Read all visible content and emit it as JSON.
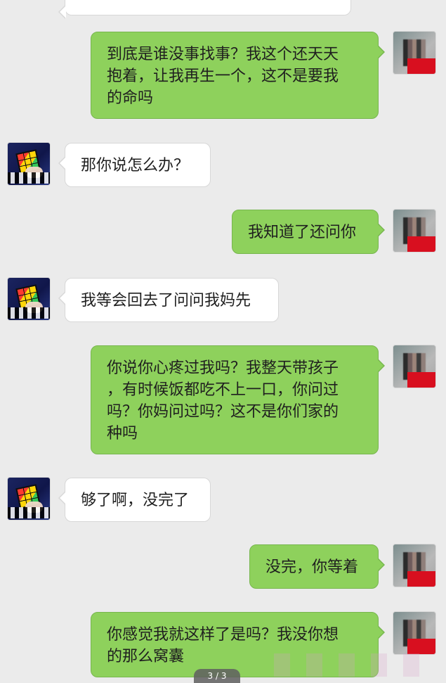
{
  "chat": {
    "messages": [
      {
        "side": "right",
        "text": "到底是谁没事找事？我这个还天天\n抱着，让我再生一个，这不是要我\n的命吗"
      },
      {
        "side": "left",
        "text": "那你说怎么办？"
      },
      {
        "side": "right",
        "text": "我知道了还问你"
      },
      {
        "side": "left",
        "text": "我等会回去了问问我妈先"
      },
      {
        "side": "right",
        "text": "你说你心疼过我吗？我整天带孩子\n，有时候饭都吃不上一口，你问过\n吗？你妈问过吗？这不是你们家的\n种吗"
      },
      {
        "side": "left",
        "text": "够了啊，没完了"
      },
      {
        "side": "right",
        "text": "没完，你等着"
      },
      {
        "side": "right",
        "text": "你感觉我就这样了是吗？我没你想\n的那么窝囊"
      }
    ]
  },
  "footer": {
    "page_indicator": "3 / 3"
  },
  "colors": {
    "background": "#ebebeb",
    "left_bubble": "#ffffff",
    "right_bubble": "#8ed15c"
  }
}
